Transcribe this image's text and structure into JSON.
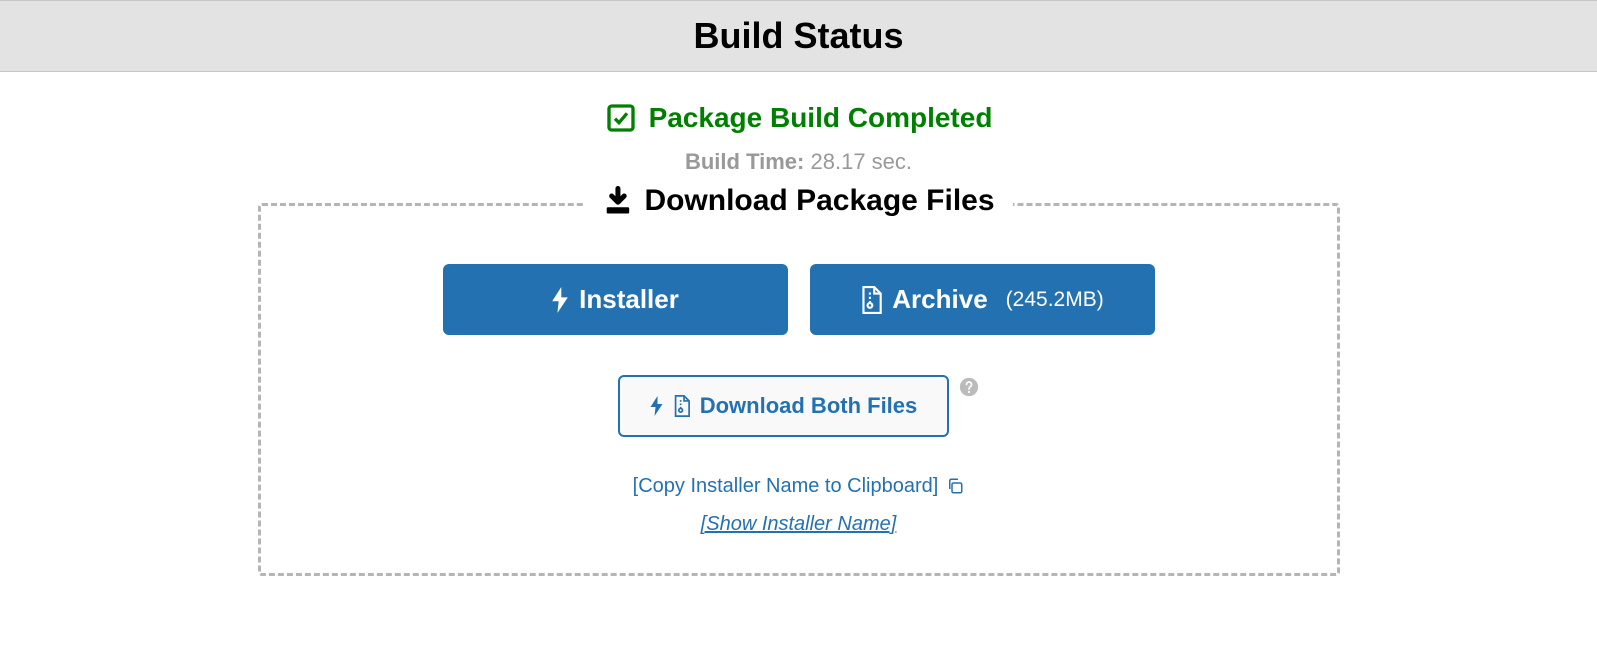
{
  "header": {
    "title": "Build Status"
  },
  "status": {
    "message": "Package Build Completed",
    "build_time_label": "Build Time:",
    "build_time_value": "28.17 sec."
  },
  "download": {
    "section_title": "Download Package Files",
    "installer_label": "Installer",
    "archive_label": "Archive",
    "archive_size": "(245.2MB)",
    "both_label": "Download Both Files",
    "copy_link": "[Copy Installer Name to Clipboard]",
    "show_link": "[Show Installer Name]"
  }
}
